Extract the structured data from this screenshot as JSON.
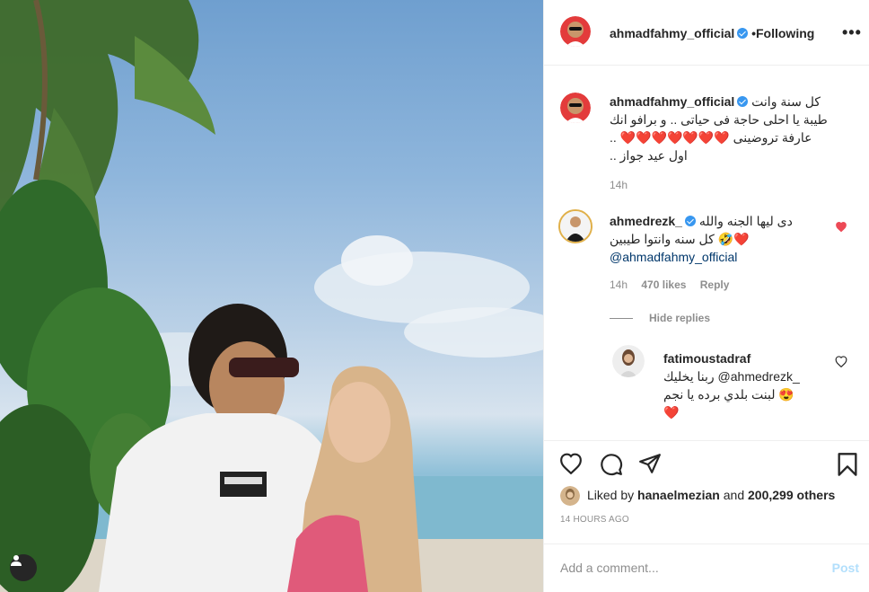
{
  "post": {
    "author": "ahmadfahmy_official",
    "follow_status": "Following",
    "separator": "•",
    "more": "•••"
  },
  "caption": {
    "username": "ahmadfahmy_official",
    "line1": "كل سنة وانت",
    "line2": "طيبة يا احلى حاجة فى حياتى .. و برافو انك",
    "line3": "عارفة تروضينى ❤️❤️❤️❤️❤️❤️❤️ ..",
    "line4": "اول عيد جواز ..",
    "time": "14h"
  },
  "comment1": {
    "username": "ahmedrezk_",
    "line1": "دى ليها الجنه والله",
    "line2": "كل سنه وانتوا طيبين 🤣❤️",
    "mention": "@ahmadfahmy_official",
    "time": "14h",
    "likes": "470 likes",
    "reply": "Reply",
    "hide_replies": "Hide replies"
  },
  "reply1": {
    "username": "fatimoustadraf",
    "line1": "ربنا يخليك @ahmedrezk_",
    "line2": "لبنت بلدي برده يا نجم 😍",
    "line3": "❤️"
  },
  "actions": {
    "liked_prefix": "Liked by",
    "liked_user": "hanaelmezian",
    "liked_and": "and",
    "liked_count": "200,299 others",
    "time_ago": "14 HOURS AGO"
  },
  "add_comment": {
    "placeholder": "Add a comment...",
    "post": "Post"
  },
  "icons": {
    "like": "heart-icon",
    "comment": "comment-icon",
    "share": "share-icon",
    "save": "bookmark-icon",
    "user_tag": "user-icon"
  },
  "colors": {
    "heart_red": "#ed4956",
    "verified_blue": "#3897f0",
    "post_disabled": "#b2dffc"
  }
}
